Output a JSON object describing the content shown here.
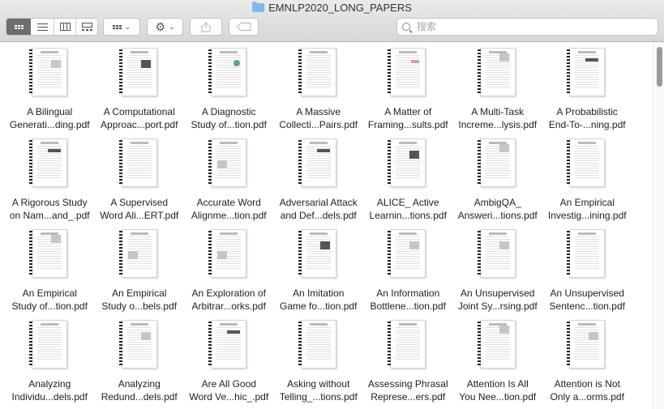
{
  "window": {
    "title": "EMNLP2020_LONG_PAPERS"
  },
  "toolbar": {
    "view_buttons": [
      {
        "name": "icon-view-button",
        "selected": true
      },
      {
        "name": "list-view-button",
        "selected": false
      },
      {
        "name": "column-view-button",
        "selected": false
      },
      {
        "name": "gallery-view-button",
        "selected": false
      }
    ],
    "search_placeholder": "搜索"
  },
  "files": [
    {
      "line1": "A Bilingual",
      "line2": "Generati...ding.pdf",
      "fig": "light"
    },
    {
      "line1": "A Computational",
      "line2": "Approac...port.pdf",
      "fig": "dark"
    },
    {
      "line1": "A Diagnostic",
      "line2": "Study of...tion.pdf",
      "fig": "green"
    },
    {
      "line1": "A Massive",
      "line2": "Collecti...Pairs.pdf",
      "fig": "none"
    },
    {
      "line1": "A Matter of",
      "line2": "Framing...sults.pdf",
      "fig": "red"
    },
    {
      "line1": "A Multi-Task",
      "line2": "Increme...lysis.pdf",
      "fig": "top"
    },
    {
      "line1": "A Probabilistic",
      "line2": "End-To-...ning.pdf",
      "fig": "dark-wide"
    },
    {
      "line1": "A Rigorous Study",
      "line2": "on Nam...and_.pdf",
      "fig": "dark-wide"
    },
    {
      "line1": "A Supervised",
      "line2": "Word Ali...ERT.pdf",
      "fig": "none"
    },
    {
      "line1": "Accurate Word",
      "line2": "Alignme...tion.pdf",
      "fig": "left"
    },
    {
      "line1": "Adversarial Attack",
      "line2": "and Def...dels.pdf",
      "fig": "dark-wide"
    },
    {
      "line1": "ALICE_ Active",
      "line2": "Learnin...tions.pdf",
      "fig": "dark"
    },
    {
      "line1": "AmbigQA_",
      "line2": "Answeri...tions.pdf",
      "fig": "top"
    },
    {
      "line1": "An Empirical",
      "line2": "Investig...ining.pdf",
      "fig": "none"
    },
    {
      "line1": "An Empirical",
      "line2": "Study of...tion.pdf",
      "fig": "top"
    },
    {
      "line1": "An Empirical",
      "line2": "Study o...bels.pdf",
      "fig": "left"
    },
    {
      "line1": "An Exploration of",
      "line2": "Arbitrar...orks.pdf",
      "fig": "left"
    },
    {
      "line1": "An Imitation",
      "line2": "Game fo...tion.pdf",
      "fig": "dark"
    },
    {
      "line1": "An Information",
      "line2": "Bottlene...tion.pdf",
      "fig": "light"
    },
    {
      "line1": "An Unsupervised",
      "line2": "Joint Sy...rsing.pdf",
      "fig": "light"
    },
    {
      "line1": "An Unsupervised",
      "line2": "Sentenc...tion.pdf",
      "fig": "none"
    },
    {
      "line1": "Analyzing",
      "line2": "Individu...dels.pdf",
      "fig": "none"
    },
    {
      "line1": "Analyzing",
      "line2": "Redund...dels.pdf",
      "fig": "light"
    },
    {
      "line1": "Are All Good",
      "line2": "Word Ve...hic_.pdf",
      "fig": "dark-wide"
    },
    {
      "line1": "Asking without",
      "line2": "Telling_...tions.pdf",
      "fig": "none"
    },
    {
      "line1": "Assessing Phrasal",
      "line2": "Represe...ers.pdf",
      "fig": "none"
    },
    {
      "line1": "Attention Is All",
      "line2": "You Nee...tion.pdf",
      "fig": "top"
    },
    {
      "line1": "Attention is Not",
      "line2": "Only a...orms.pdf",
      "fig": "light"
    }
  ]
}
